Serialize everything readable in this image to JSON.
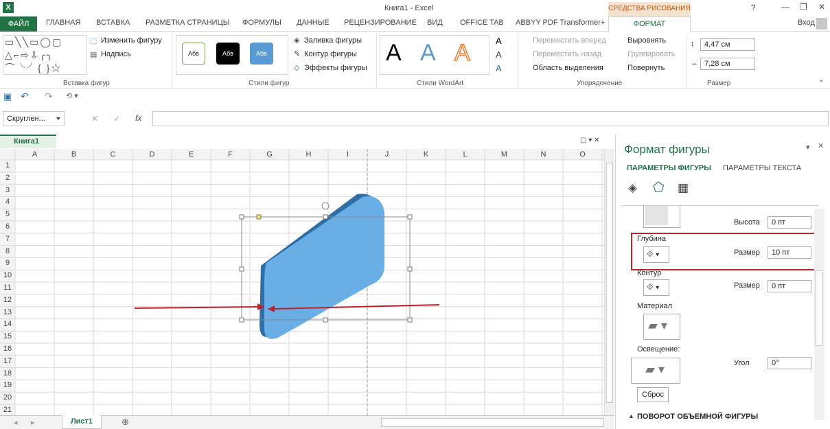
{
  "window": {
    "title": "Книга1 - Excel",
    "help": "?",
    "min": "—",
    "restore": "❐",
    "close": "✕"
  },
  "drawing_tools": "СРЕДСТВА РИСОВАНИЯ",
  "tabs": [
    "ФАЙЛ",
    "ГЛАВНАЯ",
    "ВСТАВКА",
    "РАЗМЕТКА СТРАНИЦЫ",
    "ФОРМУЛЫ",
    "ДАННЫЕ",
    "РЕЦЕНЗИРОВАНИЕ",
    "ВИД",
    "OFFICE TAB",
    "ABBYY PDF Transformer+",
    "ФОРМАТ"
  ],
  "signin": "Вход",
  "ribbon": {
    "insert_shapes": {
      "label": "Вставка фигур",
      "edit_shape": "Изменить фигуру",
      "textbox": "Надпись"
    },
    "shape_styles": {
      "label": "Стили фигур",
      "swatch": "Абв",
      "fill": "Заливка фигуры",
      "outline": "Контур фигуры",
      "effects": "Эффекты фигуры"
    },
    "wordart": {
      "label": "Стили WordArt",
      "letter": "A"
    },
    "arrange": {
      "label": "Упорядочение",
      "forward": "Переместить вперед",
      "backward": "Переместить назад",
      "selection_pane": "Область выделения",
      "align": "Выровнять",
      "group": "Группировать",
      "rotate": "Повернуть"
    },
    "size": {
      "label": "Размер",
      "height": "4,47 см",
      "width": "7,28 см"
    }
  },
  "namebox": "Скруглен...",
  "formula_icons": {
    "cancel": "✕",
    "enter": "✓",
    "fx": "fx"
  },
  "workbook_tab": "Книга1",
  "columns": [
    "A",
    "B",
    "C",
    "D",
    "E",
    "F",
    "G",
    "H",
    "I",
    "J",
    "K",
    "L",
    "M",
    "N",
    "O"
  ],
  "rows": [
    "1",
    "2",
    "3",
    "4",
    "5",
    "6",
    "7",
    "8",
    "9",
    "10",
    "11",
    "12",
    "13",
    "14",
    "15",
    "16",
    "17",
    "18",
    "19",
    "20",
    "21"
  ],
  "sheet_tab": "Лист1",
  "pane": {
    "title": "Формат фигуры",
    "tab_shape": "ПАРАМЕТРЫ ФИГУРЫ",
    "tab_text": "ПАРАМЕТРЫ ТЕКСТА",
    "height_label": "Высота",
    "height_value": "0 пт",
    "depth_label": "Глубина",
    "depth_size_label": "Размер",
    "depth_size_value": "10 пт",
    "contour_label": "Контур",
    "contour_size_label": "Размер",
    "contour_size_value": "0 пт",
    "material_label": "Материал",
    "lighting_label": "Освещение:",
    "angle_label": "Угол",
    "angle_value": "0°",
    "reset": "Сброс",
    "rotation_section": "ПОВОРОТ ОБЪЕМНОЙ ФИГУРЫ"
  },
  "colors": {
    "excel_green": "#217346",
    "highlight": "#c0202a",
    "shape_fill": "#6aaee6",
    "shape_side": "#2e6fa8"
  }
}
